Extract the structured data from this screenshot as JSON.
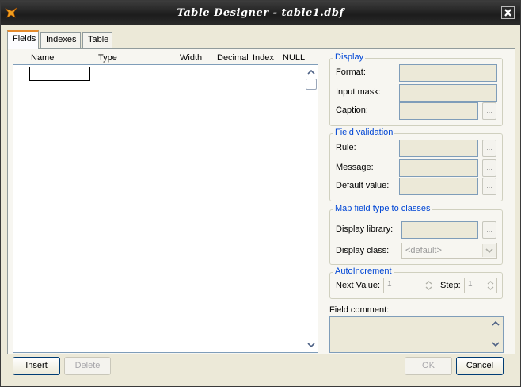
{
  "window": {
    "title": "Table Designer - table1.dbf"
  },
  "tabs": [
    {
      "label": "Fields",
      "active": true
    },
    {
      "label": "Indexes",
      "active": false
    },
    {
      "label": "Table",
      "active": false
    }
  ],
  "grid": {
    "columns": [
      "Name",
      "Type",
      "Width",
      "Decimal",
      "Index",
      "NULL"
    ],
    "name_value": ""
  },
  "display": {
    "title": "Display",
    "format_label": "Format:",
    "format_value": "",
    "input_mask_label": "Input mask:",
    "input_mask_value": "",
    "caption_label": "Caption:",
    "caption_value": ""
  },
  "validation": {
    "title": "Field validation",
    "rule_label": "Rule:",
    "rule_value": "",
    "message_label": "Message:",
    "message_value": "",
    "default_label": "Default value:",
    "default_value": ""
  },
  "map_classes": {
    "title": "Map field type to classes",
    "library_label": "Display library:",
    "library_value": "",
    "class_label": "Display class:",
    "class_value": "<default>"
  },
  "autoincrement": {
    "title": "AutoIncrement",
    "next_value_label": "Next Value:",
    "next_value": "1",
    "step_label": "Step:",
    "step_value": "1"
  },
  "comment": {
    "label": "Field comment:",
    "value": ""
  },
  "buttons": {
    "insert": "Insert",
    "delete": "Delete",
    "ok": "OK",
    "cancel": "Cancel",
    "ellipsis": "..."
  },
  "colors": {
    "accent_tab": "#e68b2c",
    "group_title": "#0046d5",
    "field_border": "#7f9db9"
  }
}
